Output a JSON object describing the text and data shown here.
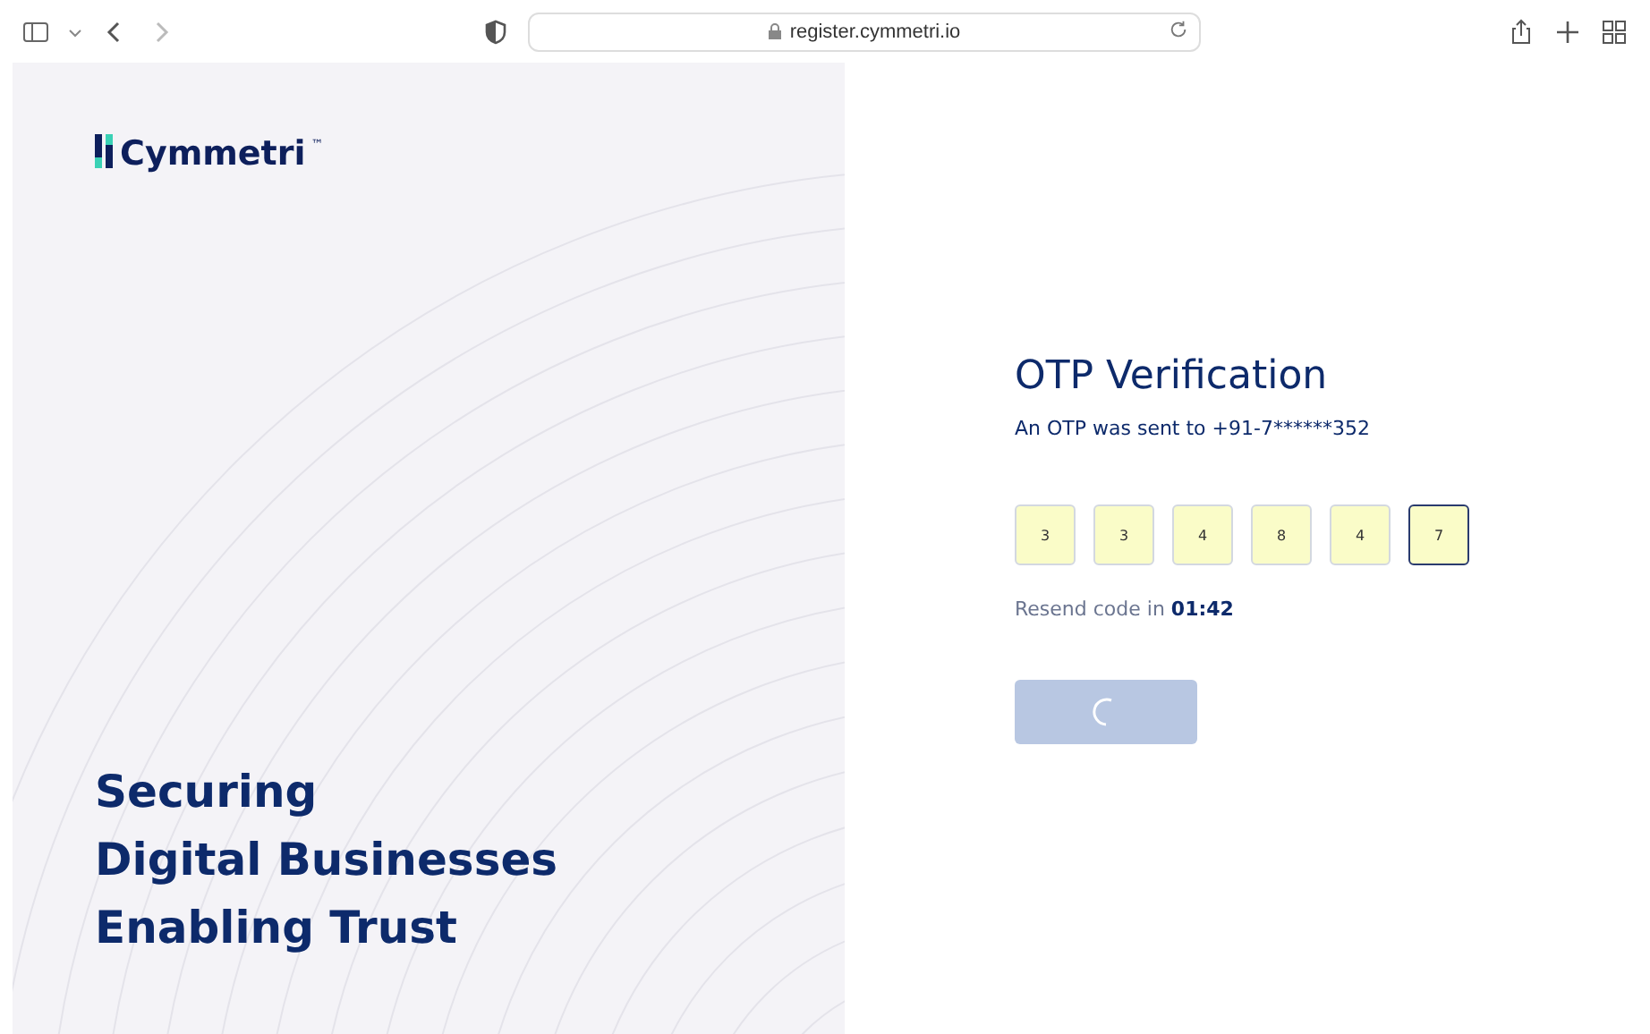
{
  "browser": {
    "url": "register.cymmetri.io"
  },
  "brand": {
    "name": "Cymmetri",
    "trademark": "™"
  },
  "tagline": [
    "Securing",
    "Digital Businesses",
    "Enabling Trust"
  ],
  "otp": {
    "title": "OTP Verification",
    "subtitle": "An OTP was sent to +91-7******352",
    "digits": [
      {
        "value": "3",
        "selected": false
      },
      {
        "value": "3",
        "selected": false
      },
      {
        "value": "4",
        "selected": false
      },
      {
        "value": "8",
        "selected": false
      },
      {
        "value": "4",
        "selected": false
      },
      {
        "value": "7",
        "selected": true
      }
    ],
    "resend": "Resend code in **01:42**",
    "submit": {
      "disabled": true
    }
  }
}
